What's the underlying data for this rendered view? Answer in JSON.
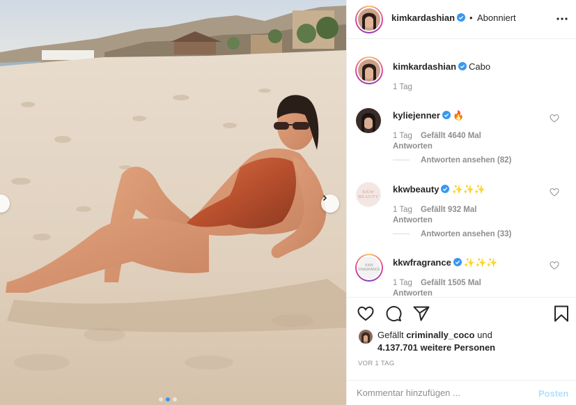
{
  "header": {
    "username": "kimkardashian",
    "separator": "•",
    "follow_status": "Abonniert",
    "more_icon": "more-horizontal-icon"
  },
  "caption": {
    "username": "kimkardashian",
    "text": "Cabo",
    "time": "1 Tag"
  },
  "comments": [
    {
      "username": "kyliejenner",
      "text": "🔥",
      "time": "1 Tag",
      "likes": "Gefällt 4640 Mal",
      "reply": "Antworten",
      "view_replies": "Antworten ansehen (82)"
    },
    {
      "username": "kkwbeauty",
      "text": "✨✨✨",
      "time": "1 Tag",
      "likes": "Gefällt 932 Mal",
      "reply": "Antworten",
      "view_replies": "Antworten ansehen (33)",
      "avatar_text": "KKW BEAUTY"
    },
    {
      "username": "kkwfragrance",
      "text": "✨✨✨",
      "time": "1 Tag",
      "likes": "Gefällt 1505 Mal",
      "reply": "Antworten",
      "avatar_text": "KKW FRAGRANCE"
    }
  ],
  "likes": {
    "prefix": "Gefällt",
    "user": "criminally_coco",
    "connector": "und",
    "count": "4.137.701",
    "suffix": "weitere Personen"
  },
  "post_date": "VOR 1 TAG",
  "comment_box": {
    "placeholder": "Kommentar hinzufügen ...",
    "post_label": "Posten"
  },
  "carousel": {
    "slide_count": 3,
    "active_slide": 1
  },
  "colors": {
    "verified": "#3897f0",
    "post_disabled": "#b2dffc",
    "secondary_text": "#8e8e8e",
    "primary_text": "#262626"
  }
}
